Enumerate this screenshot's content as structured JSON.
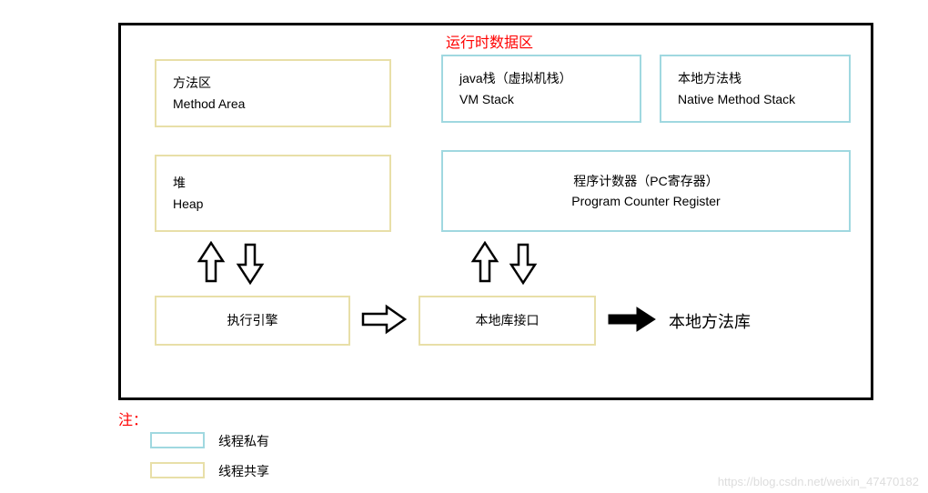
{
  "title": "运行时数据区",
  "boxes": {
    "method_area": {
      "line1": "方法区",
      "line2": "Method Area"
    },
    "heap": {
      "line1": "堆",
      "line2": "Heap"
    },
    "vm_stack": {
      "line1": "java栈（虚拟机栈）",
      "line2": "VM Stack"
    },
    "native_stack": {
      "line1": "本地方法栈",
      "line2": "Native Method Stack"
    },
    "pc_register": {
      "line1": "程序计数器（PC寄存器）",
      "line2": "Program Counter Register"
    },
    "exec_engine": "执行引擎",
    "native_lib_interface": "本地库接口"
  },
  "native_method_lib": "本地方法库",
  "note": "注：",
  "legend": {
    "private": "线程私有",
    "shared": "线程共享"
  },
  "watermark": "https://blog.csdn.net/weixin_47470182"
}
